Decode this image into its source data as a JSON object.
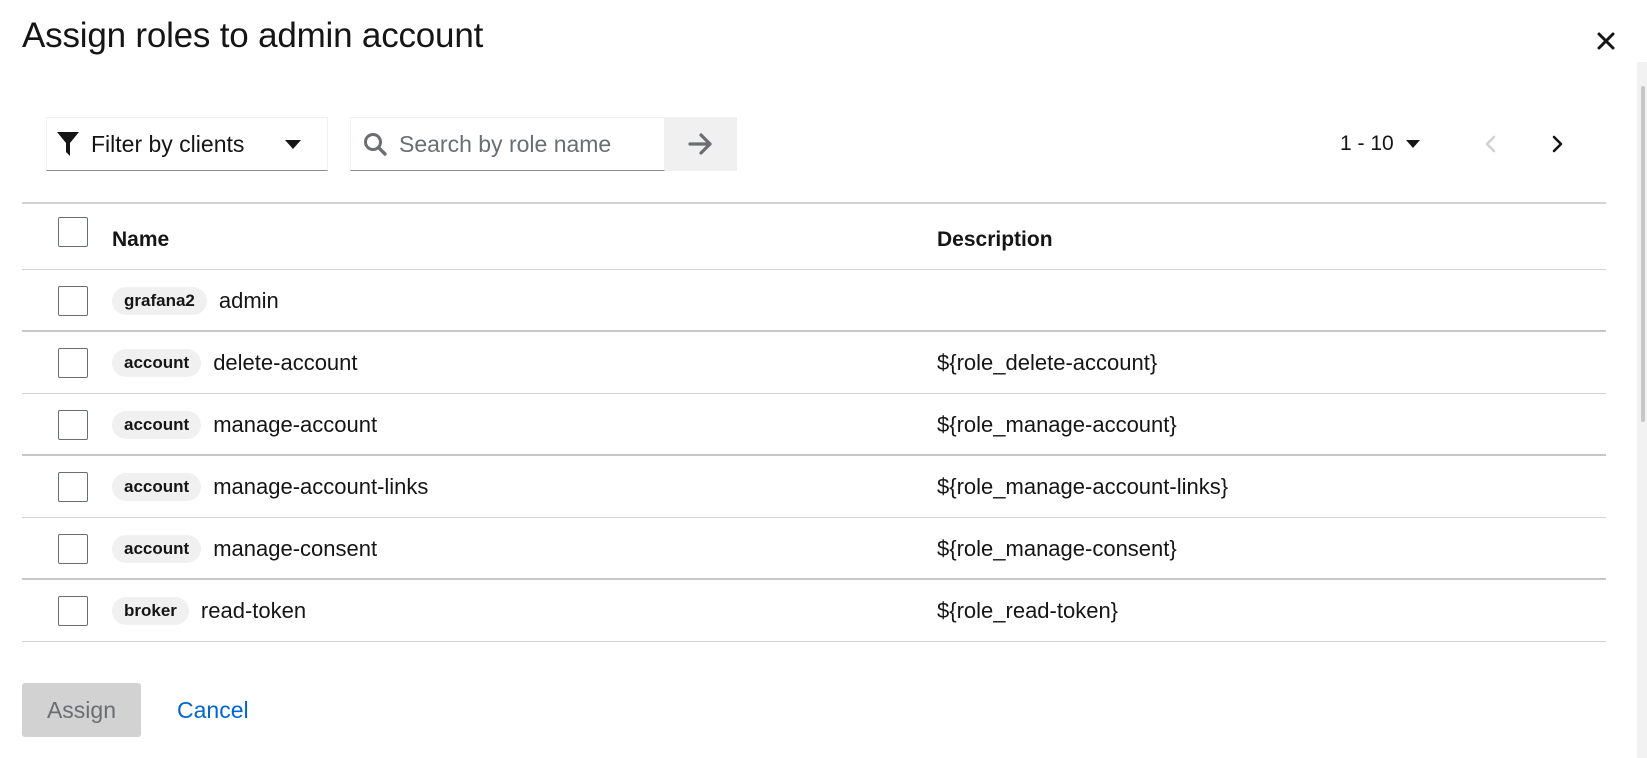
{
  "modal": {
    "title": "Assign roles to admin account",
    "close_icon": "close-icon"
  },
  "toolbar": {
    "filter_label": "Filter by clients",
    "filter_icon": "filter-icon",
    "search_placeholder": "Search by role name",
    "search_value": "",
    "pagination_label": "1 - 10"
  },
  "table": {
    "columns": {
      "name": "Name",
      "description": "Description"
    },
    "rows": [
      {
        "client": "grafana2",
        "name": "admin",
        "description": ""
      },
      {
        "client": "account",
        "name": "delete-account",
        "description": "${role_delete-account}"
      },
      {
        "client": "account",
        "name": "manage-account",
        "description": "${role_manage-account}"
      },
      {
        "client": "account",
        "name": "manage-account-links",
        "description": "${role_manage-account-links}"
      },
      {
        "client": "account",
        "name": "manage-consent",
        "description": "${role_manage-consent}"
      },
      {
        "client": "broker",
        "name": "read-token",
        "description": "${role_read-token}"
      }
    ]
  },
  "footer": {
    "assign_label": "Assign",
    "cancel_label": "Cancel"
  },
  "colors": {
    "link": "#0066cc",
    "disabled_button_bg": "#d2d2d2",
    "badge_bg": "#f0f0f0",
    "border": "#d2d2d2"
  }
}
